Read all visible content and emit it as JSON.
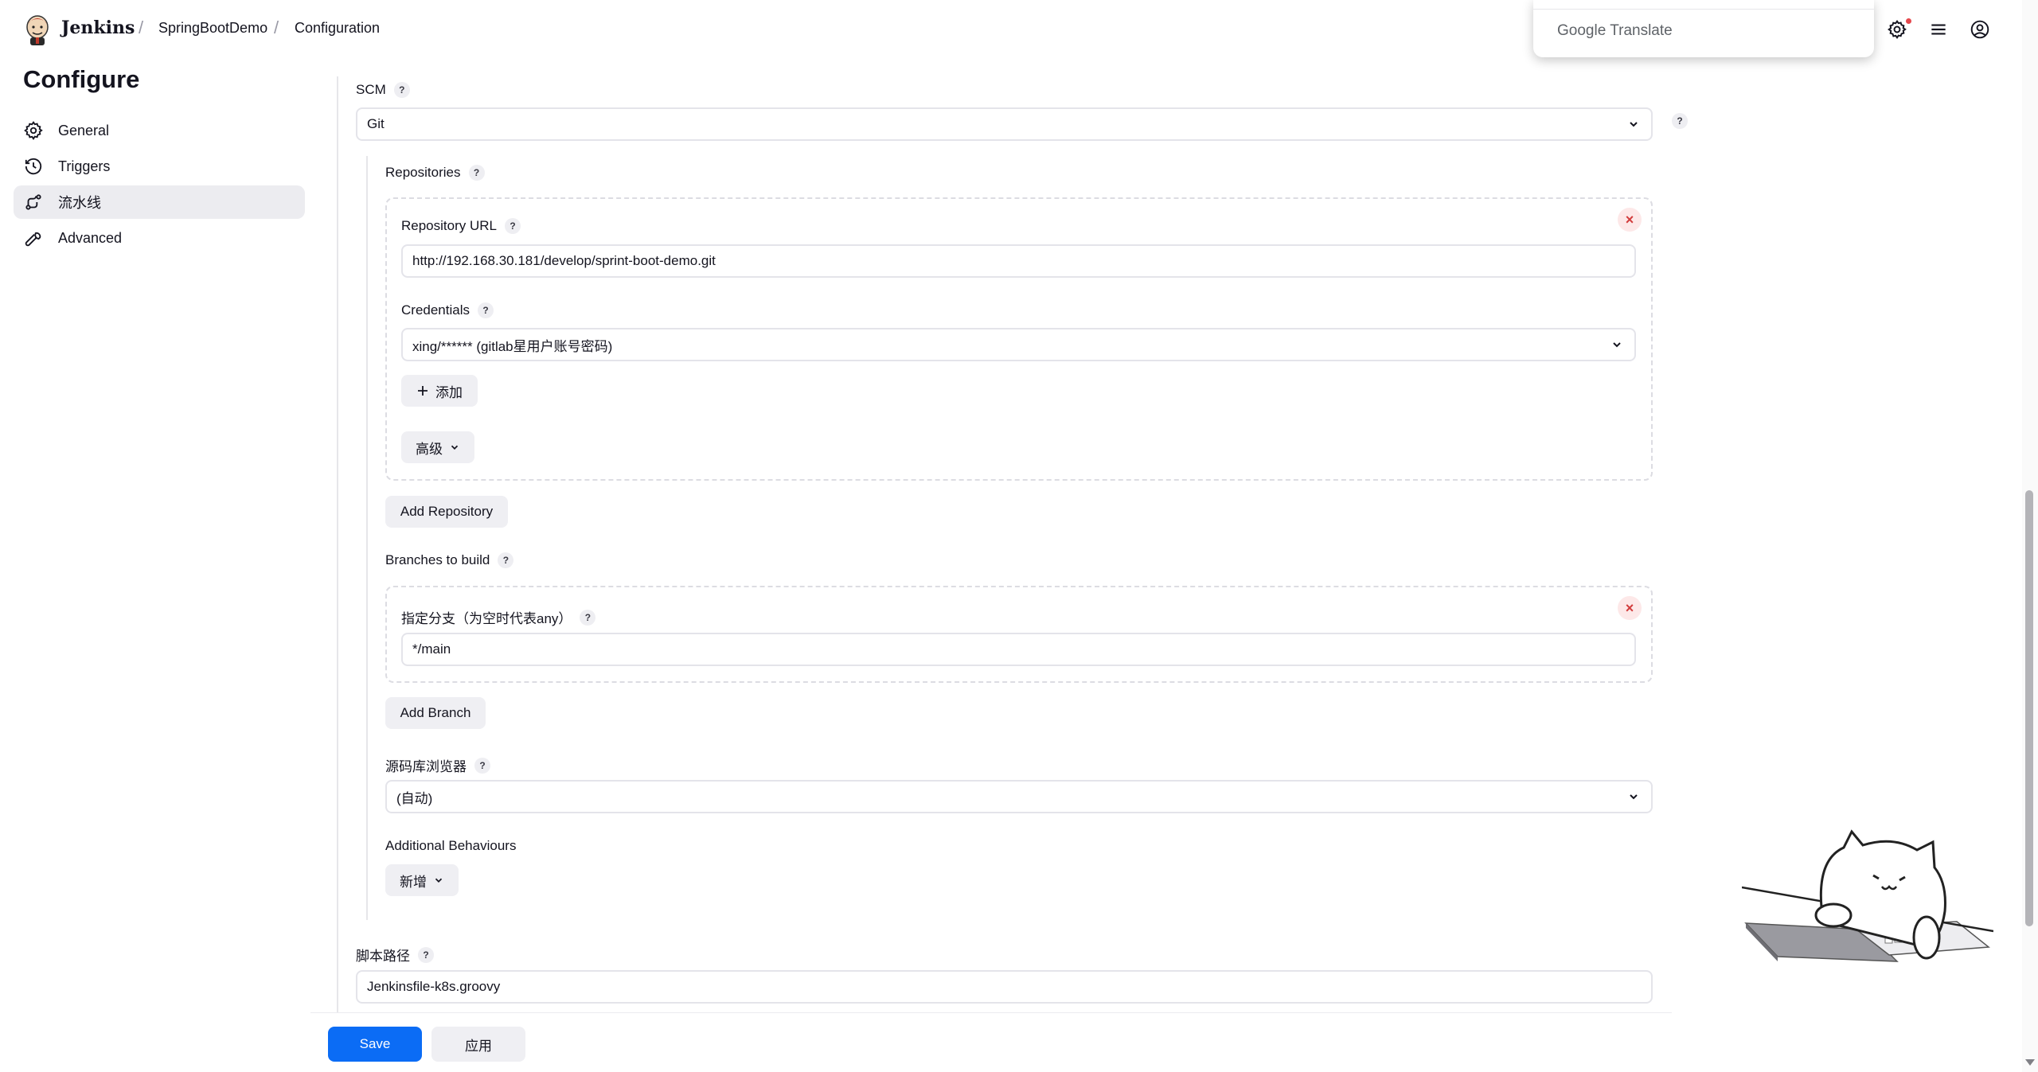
{
  "header": {
    "brand": "Jenkins",
    "breadcrumbs": [
      "SpringBootDemo",
      "Configuration"
    ],
    "separator": "/",
    "icons": [
      "jenkins-logo-icon",
      "settings-icon",
      "menu-icon",
      "account-icon"
    ]
  },
  "translate_popup": {
    "brand": "Google",
    "product": "Translate"
  },
  "sidebar": {
    "title": "Configure",
    "items": [
      {
        "label": "General",
        "icon": "gear-icon"
      },
      {
        "label": "Triggers",
        "icon": "clock-icon"
      },
      {
        "label": "流水线",
        "icon": "pipeline-icon",
        "active": true
      },
      {
        "label": "Advanced",
        "icon": "wrench-icon"
      }
    ]
  },
  "help_glyph": "?",
  "scm": {
    "label": "SCM",
    "value": "Git",
    "repositories": {
      "label": "Repositories",
      "url_label": "Repository URL",
      "url_value": "http://192.168.30.181/develop/sprint-boot-demo.git",
      "credentials_label": "Credentials",
      "credentials_value": "xing/****** (gitlab星用户账号密码)",
      "add_label": "添加",
      "advanced_label": "高级",
      "add_repository_label": "Add Repository",
      "remove_glyph": "×"
    },
    "branches": {
      "label": "Branches to build",
      "branch_label": "指定分支（为空时代表any）",
      "branch_value": "*/main",
      "add_branch_label": "Add Branch",
      "remove_glyph": "×"
    },
    "browser": {
      "label": "源码库浏览器",
      "value": "(自动)"
    },
    "behaviours": {
      "label": "Additional Behaviours",
      "add_label": "新增"
    }
  },
  "script_path": {
    "label": "脚本路径",
    "value": "Jenkinsfile-k8s.groovy"
  },
  "footer": {
    "save_label": "Save",
    "apply_label": "应用"
  },
  "colors": {
    "primary": "#0b6cf5",
    "remove": "#d23c3c",
    "active_bg": "#ececf0"
  }
}
